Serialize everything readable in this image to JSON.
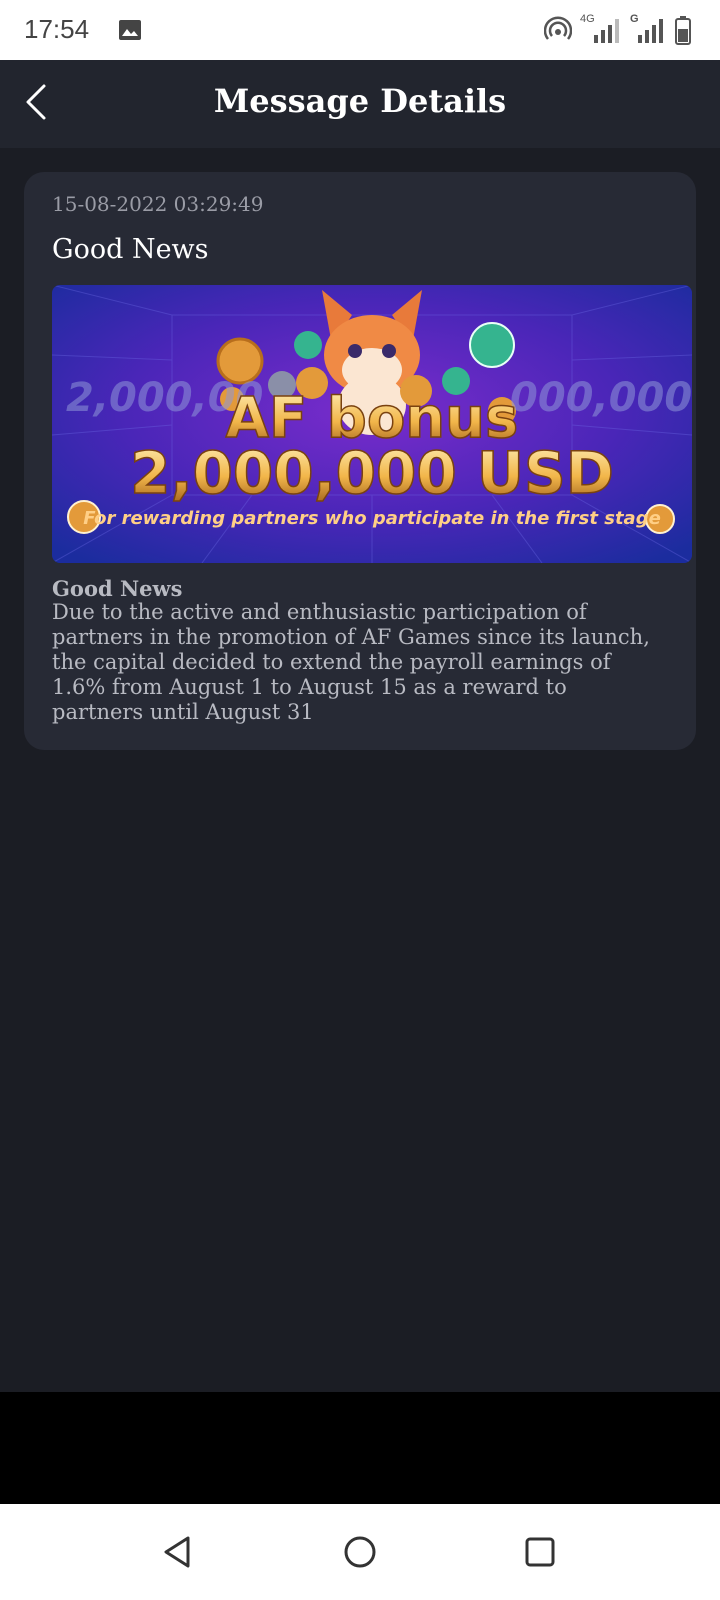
{
  "status_bar": {
    "time": "17:54",
    "icons": [
      "image-icon",
      "hotspot-icon",
      "signal-4g-icon",
      "signal-g-icon",
      "battery-icon"
    ],
    "net_4g": "4G",
    "net_g": "G"
  },
  "header": {
    "title": "Message Details",
    "back_icon": "chevron-left-icon"
  },
  "message": {
    "date": "15-08-2022 03:29:49",
    "title": "Good News",
    "banner": {
      "side_amount_left": "2,000,00",
      "side_amount_right": "000,000 $",
      "line1": "AF bonus",
      "line2": "2,000,000 USD",
      "tagline": "For rewarding partners who participate in the first stage"
    },
    "body_heading": "Good News",
    "body_text": "Due to the active and enthusiastic participation of partners in the promotion of AF Games since its launch, the capital decided to extend the payroll earnings of 1.6% from August 1 to August 15 as a reward to partners until August 31"
  },
  "nav_bar": {
    "buttons": [
      "back-triangle-icon",
      "home-circle-icon",
      "recents-square-icon"
    ]
  },
  "colors": {
    "background": "#1b1d24",
    "header": "#22252e",
    "card": "#272a35",
    "banner_blue": "#1e2aa0",
    "banner_purple": "#6a2bbf",
    "gold": "#f0b84a"
  }
}
